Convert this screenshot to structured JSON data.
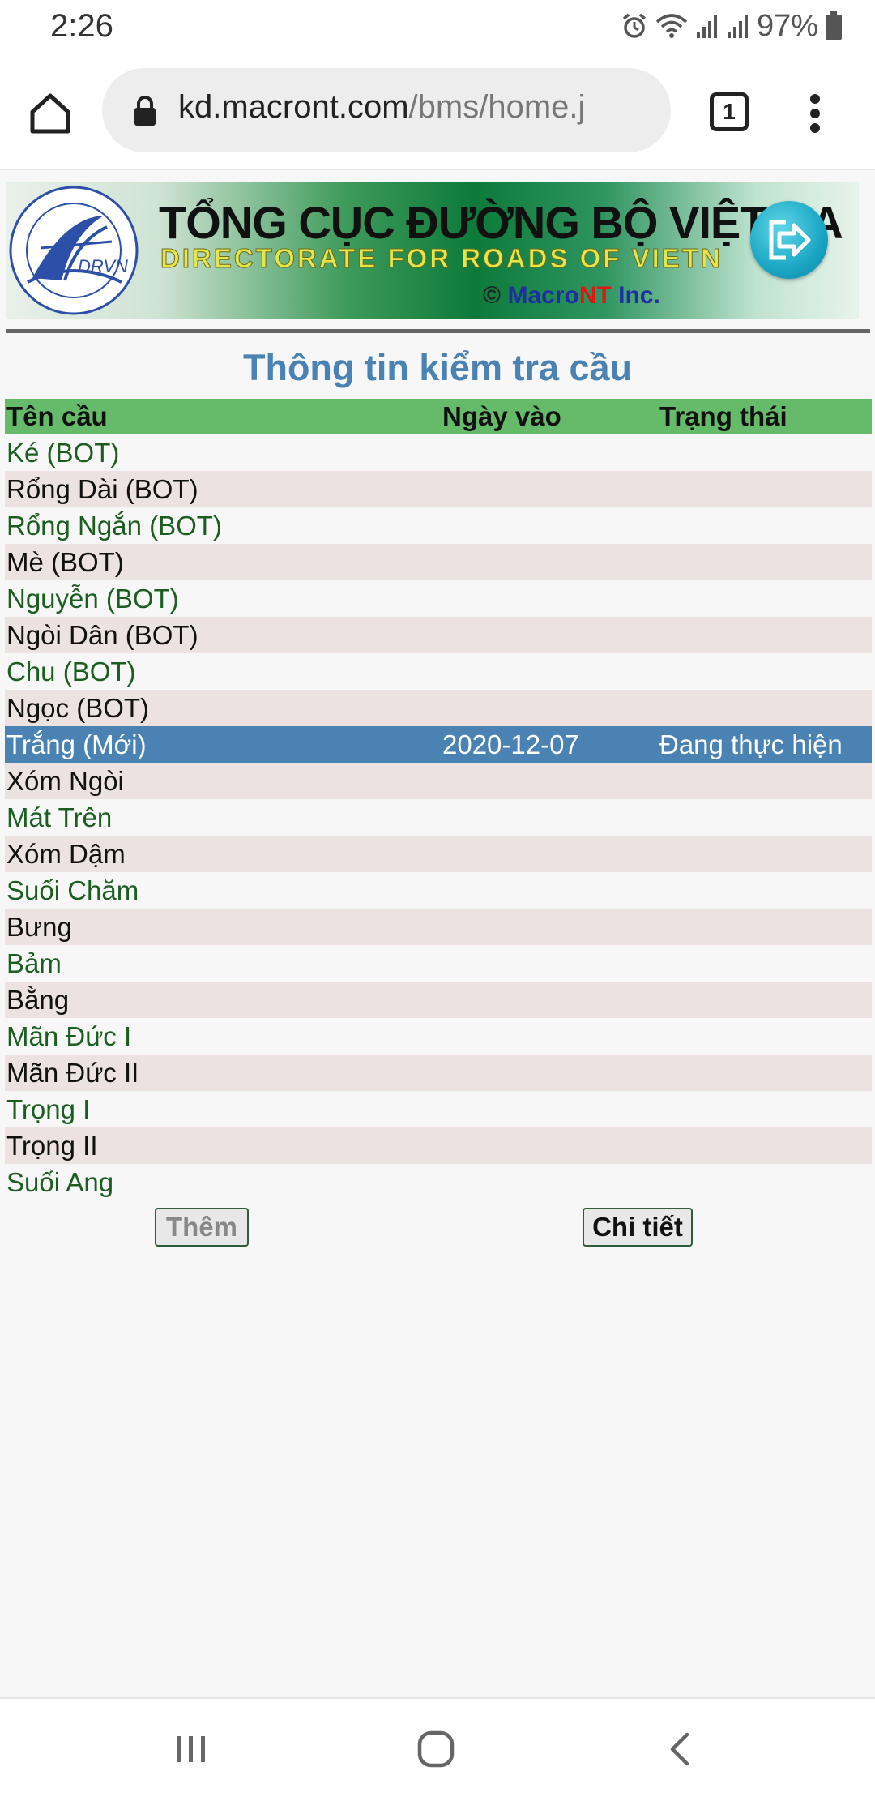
{
  "status_bar": {
    "time": "2:26",
    "battery": "97%"
  },
  "browser": {
    "url_domain": "kd.macront.com",
    "url_path": "/bms/home.j",
    "tab_count": "1"
  },
  "banner": {
    "title": "TỔNG CỤC ĐƯỜNG BỘ VIỆT NA",
    "subtitle": "DIRECTORATE FOR ROADS OF VIETN",
    "copyright_symbol": "©",
    "company_a": "Macro",
    "company_b": "NT",
    "company_c": " Inc.",
    "logo_text": "DRVN"
  },
  "page_title": "Thông tin kiểm tra cầu",
  "table": {
    "headers": [
      "Tên cầu",
      "Ngày vào",
      "Trạng thái"
    ],
    "rows": [
      [
        "Ké (BOT)",
        "",
        ""
      ],
      [
        "Rổng Dài (BOT)",
        "",
        ""
      ],
      [
        "Rổng Ngắn (BOT)",
        "",
        ""
      ],
      [
        "Mè (BOT)",
        "",
        ""
      ],
      [
        "Nguyễn (BOT)",
        "",
        ""
      ],
      [
        "Ngòi Dân (BOT)",
        "",
        ""
      ],
      [
        "Chu (BOT)",
        "",
        ""
      ],
      [
        "Ngọc (BOT)",
        "",
        ""
      ],
      [
        "Trắng (Mới)",
        "2020-12-07",
        "Đang thực hiện"
      ],
      [
        "Xóm Ngòi",
        "",
        ""
      ],
      [
        "Mát Trên",
        "",
        ""
      ],
      [
        "Xóm Dậm",
        "",
        ""
      ],
      [
        "Suối Chăm",
        "",
        ""
      ],
      [
        "Bưng",
        "",
        ""
      ],
      [
        "Bảm",
        "",
        ""
      ],
      [
        "Bằng",
        "",
        ""
      ],
      [
        "Mãn Đức I",
        "",
        ""
      ],
      [
        "Mãn Đức II",
        "",
        ""
      ],
      [
        "Trọng I",
        "",
        ""
      ],
      [
        "Trọng II",
        "",
        ""
      ],
      [
        "Suối Ang",
        "",
        ""
      ]
    ],
    "selected_index": 8
  },
  "buttons": {
    "add": "Thêm",
    "detail": "Chi tiết"
  },
  "colors": {
    "header_green": "#66bb6a",
    "selected_blue": "#4a82b4",
    "title_blue": "#4a82b4",
    "row_tint": "#ece2e2",
    "text_green": "#1b5e20"
  }
}
